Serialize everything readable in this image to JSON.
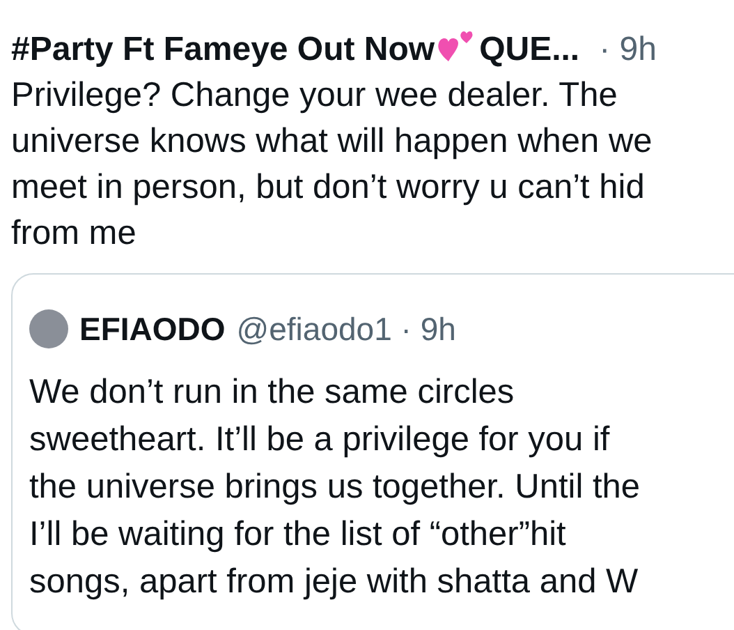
{
  "tweet": {
    "author": "#Party Ft Fameye Out Now",
    "author_suffix": "QUE...",
    "time": "· 9h",
    "lines": [
      "Privilege? Change your wee dealer. The",
      "universe knows what will happen when we",
      "meet in person, but don’t worry u can’t hid",
      "from me"
    ]
  },
  "quoted": {
    "name": "EFIAODO",
    "handle": "@efiaodo1 · 9h",
    "lines": [
      "We don’t run in the same circles",
      "sweetheart. It’ll be a privilege for you if",
      "the universe brings us together. Until the",
      "I’ll be waiting for the list of “other”hit",
      "songs, apart from jeje with shatta and W"
    ]
  }
}
